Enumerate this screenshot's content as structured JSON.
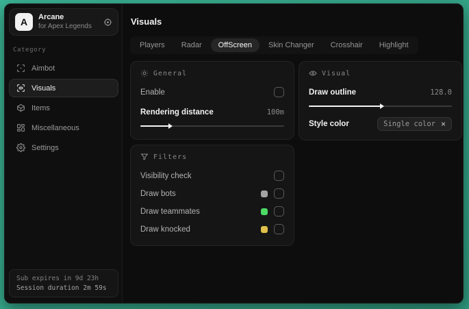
{
  "sidebar": {
    "logo": {
      "letter": "A",
      "title": "Arcane",
      "subtitle": "for Apex Legends"
    },
    "category_label": "Category",
    "items": [
      {
        "label": "Aimbot"
      },
      {
        "label": "Visuals"
      },
      {
        "label": "Items"
      },
      {
        "label": "Miscellaneous"
      },
      {
        "label": "Settings"
      }
    ],
    "status": {
      "line1": "Sub expires in 9d 23h",
      "line2": "Session duration 2m 59s"
    }
  },
  "main": {
    "title": "Visuals",
    "tabs": [
      {
        "label": "Players"
      },
      {
        "label": "Radar"
      },
      {
        "label": "OffScreen"
      },
      {
        "label": "Skin Changer"
      },
      {
        "label": "Crosshair"
      },
      {
        "label": "Highlight"
      }
    ],
    "active_tab": "OffScreen"
  },
  "panels": {
    "general": {
      "title": "General",
      "enable_label": "Enable",
      "rendering_label": "Rendering distance",
      "rendering_value": "100m",
      "rendering_percent": 20
    },
    "visual": {
      "title": "Visual",
      "outline_label": "Draw outline",
      "outline_value": "128.0",
      "outline_percent": 50,
      "style_label": "Style color",
      "style_value": "Single color",
      "clear_glyph": "×"
    },
    "filters": {
      "title": "Filters",
      "visibility_label": "Visibility check",
      "bots_label": "Draw bots",
      "bots_swatch": "#a3a3a3",
      "teammates_label": "Draw teammates",
      "teammates_swatch": "#4cd964",
      "knocked_label": "Draw knocked",
      "knocked_swatch": "#e0c04a"
    }
  },
  "colors": {
    "desktop_accent": "#35a98c",
    "window_bg": "#0d0d0d",
    "panel_bg": "#151515"
  }
}
